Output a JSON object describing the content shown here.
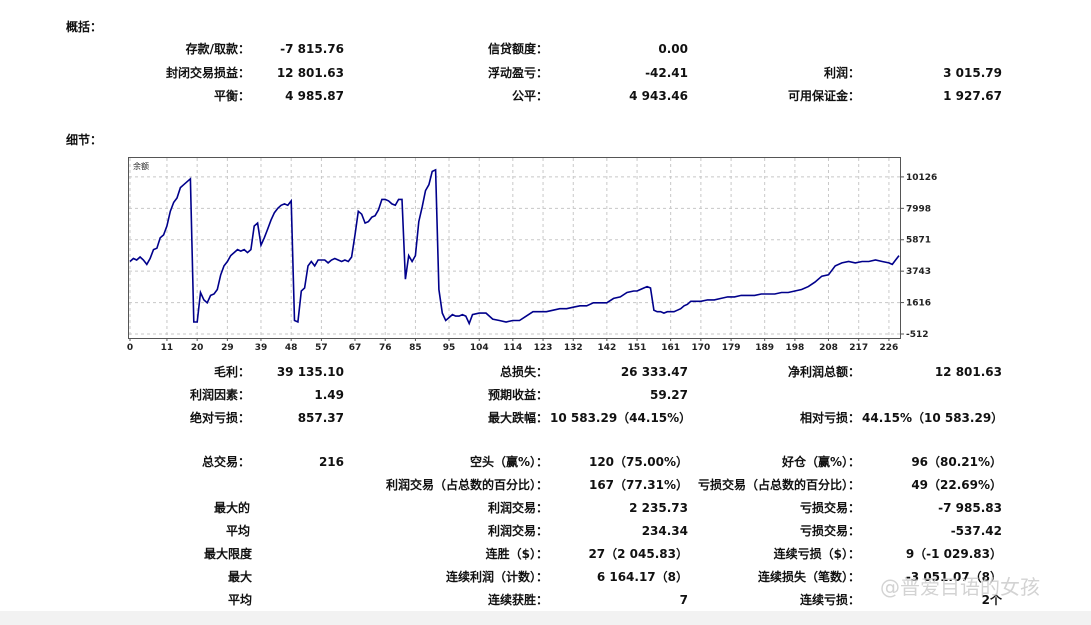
{
  "summary": {
    "title": "概括：",
    "rows": [
      [
        {
          "label": "存款/取款：",
          "value": "-7 815.76"
        },
        {
          "label": "信贷额度：",
          "value": "0.00"
        },
        {
          "label": "",
          "value": ""
        }
      ],
      [
        {
          "label": "封闭交易损益：",
          "value": "12 801.63"
        },
        {
          "label": "浮动盈亏：",
          "value": "-42.41"
        },
        {
          "label": "利润：",
          "value": "3 015.79"
        }
      ],
      [
        {
          "label": "平衡：",
          "value": "4 985.87"
        },
        {
          "label": "公平：",
          "value": "4 943.46"
        },
        {
          "label": "可用保证金：",
          "value": "1 927.67"
        }
      ]
    ]
  },
  "details": {
    "title": "细节："
  },
  "chart_data": {
    "type": "line",
    "title": "余额",
    "xlabel": "",
    "ylabel": "",
    "x_ticks": [
      0,
      11,
      20,
      29,
      39,
      48,
      57,
      67,
      76,
      85,
      95,
      104,
      114,
      123,
      132,
      142,
      151,
      161,
      170,
      179,
      189,
      198,
      208,
      217,
      226
    ],
    "y_ticks": [
      10126,
      7998,
      5871,
      3743,
      1616,
      -512
    ],
    "xlim": [
      0,
      229
    ],
    "ylim": [
      -512,
      11000
    ],
    "grid": true,
    "line_color": "#00008b",
    "series": [
      {
        "x": [
          0,
          1,
          2,
          3,
          4,
          5,
          6,
          7,
          8,
          9,
          10,
          11,
          12,
          13,
          14,
          15,
          16,
          17,
          18,
          19,
          20,
          21,
          22,
          23,
          24,
          25,
          26,
          27,
          28,
          29,
          30,
          31,
          32,
          33,
          34,
          35,
          36,
          37,
          38,
          39,
          40,
          41,
          42,
          43,
          44,
          45,
          46,
          47,
          48,
          49,
          50,
          51,
          52,
          53,
          54,
          55,
          56,
          57,
          58,
          59,
          60,
          61,
          62,
          63,
          64,
          65,
          66,
          67,
          68,
          69,
          70,
          71,
          72,
          73,
          74,
          75,
          76,
          77,
          78,
          79,
          80,
          81,
          82,
          83,
          84,
          85,
          86,
          87,
          88,
          89,
          90,
          91,
          92,
          93,
          94,
          95,
          96,
          97,
          98,
          99,
          100,
          101,
          102,
          104,
          106,
          108,
          110,
          112,
          114,
          116,
          118,
          120,
          122,
          124,
          126,
          128,
          130,
          132,
          134,
          136,
          138,
          140,
          142,
          144,
          146,
          148,
          150,
          151,
          152,
          153,
          154,
          155,
          156,
          157,
          158,
          159,
          160,
          161,
          162,
          163,
          164,
          165,
          166,
          167,
          168,
          170,
          172,
          174,
          176,
          178,
          180,
          182,
          184,
          186,
          188,
          190,
          192,
          194,
          196,
          198,
          200,
          202,
          204,
          206,
          208,
          210,
          212,
          214,
          216,
          218,
          220,
          222,
          224,
          226,
          227,
          228,
          229
        ],
        "y": [
          4400,
          4600,
          4500,
          4700,
          4500,
          4200,
          4600,
          5200,
          5300,
          6000,
          6200,
          6800,
          7800,
          8400,
          8700,
          9400,
          9600,
          9800,
          10000,
          300,
          300,
          2300,
          1800,
          1600,
          2100,
          2200,
          2500,
          3500,
          4100,
          4400,
          4800,
          5000,
          5200,
          5100,
          5200,
          5000,
          5200,
          6800,
          7000,
          5500,
          6000,
          6600,
          7200,
          7700,
          8000,
          8200,
          8300,
          8200,
          8500,
          400,
          300,
          2400,
          2600,
          4100,
          4400,
          4100,
          4500,
          4500,
          4500,
          4300,
          4500,
          4600,
          4500,
          4400,
          4500,
          4400,
          4700,
          6200,
          7800,
          7600,
          7000,
          7100,
          7400,
          7500,
          7900,
          8600,
          8600,
          8500,
          8300,
          8200,
          8600,
          8600,
          3200,
          4800,
          4400,
          4800,
          7100,
          8100,
          9200,
          9600,
          10500,
          10600,
          2500,
          900,
          400,
          600,
          800,
          700,
          700,
          800,
          700,
          200,
          800,
          900,
          900,
          500,
          400,
          300,
          400,
          400,
          700,
          1000,
          1000,
          1000,
          1100,
          1200,
          1200,
          1300,
          1400,
          1400,
          1600,
          1600,
          1600,
          1900,
          2000,
          2300,
          2400,
          2400,
          2500,
          2600,
          2700,
          2600,
          1100,
          1000,
          1000,
          900,
          1000,
          1000,
          1000,
          1100,
          1200,
          1400,
          1500,
          1700,
          1700,
          1700,
          1800,
          1800,
          1900,
          2000,
          2000,
          2100,
          2100,
          2100,
          2200,
          2200,
          2200,
          2300,
          2300,
          2400,
          2500,
          2700,
          3000,
          3400,
          3500,
          4100,
          4300,
          4400,
          4300,
          4400,
          4400,
          4500,
          4400,
          4300,
          4200,
          4500,
          4800
        ]
      }
    ]
  },
  "stats": {
    "gross_profit": {
      "label": "毛利：",
      "value": "39 135.10"
    },
    "gross_loss": {
      "label": "总损失：",
      "value": "26 333.47"
    },
    "net_profit": {
      "label": "净利润总额：",
      "value": "12 801.63"
    },
    "profit_factor": {
      "label": "利润因素：",
      "value": "1.49"
    },
    "expected_payoff": {
      "label": "预期收益：",
      "value": "59.27"
    },
    "abs_drawdown": {
      "label": "绝对亏损：",
      "value": "857.37"
    },
    "max_drawdown": {
      "label": "最大跌幅：",
      "value": "10 583.29（44.15%）"
    },
    "rel_drawdown": {
      "label": "相对亏损：",
      "value": "44.15%（10 583.29）"
    },
    "total_trades": {
      "label": "总交易：",
      "value": "216"
    },
    "short_won": {
      "label": "空头（赢%）：",
      "value": "120（75.00%）"
    },
    "long_won": {
      "label": "好仓（赢%）：",
      "value": "96（80.21%）"
    },
    "profit_trades": {
      "label": "利润交易（占总数的百分比）：",
      "value": "167（77.31%）"
    },
    "loss_trades": {
      "label": "亏损交易（占总数的百分比）：",
      "value": "49（22.69%）"
    },
    "largest": {
      "label": "最大的"
    },
    "largest_profit": {
      "label": "利润交易：",
      "value": "2 235.73"
    },
    "largest_loss": {
      "label": "亏损交易：",
      "value": "-7 985.83"
    },
    "average": {
      "label": "平均"
    },
    "avg_profit": {
      "label": "利润交易：",
      "value": "234.34"
    },
    "avg_loss": {
      "label": "亏损交易：",
      "value": "-537.42"
    },
    "maximum_limit": {
      "label": "最大限度"
    },
    "consec_wins_money": {
      "label": "连胜（$）：",
      "value": "27（2 045.83）"
    },
    "consec_losses_money": {
      "label": "连续亏损（$）：",
      "value": "9（-1 029.83）"
    },
    "maximal": {
      "label": "最大"
    },
    "consec_profit_count": {
      "label": "连续利润（计数）：",
      "value": "6 164.17（8）"
    },
    "consec_loss_count": {
      "label": "连续损失（笔数）：",
      "value": "-3 051.07（8）"
    },
    "average2": {
      "label": "平均"
    },
    "avg_consec_wins": {
      "label": "连续获胜：",
      "value": "7"
    },
    "avg_consec_losses": {
      "label": "连续亏损：",
      "value": "2个"
    }
  },
  "watermark": "@普爱目语的女孩"
}
